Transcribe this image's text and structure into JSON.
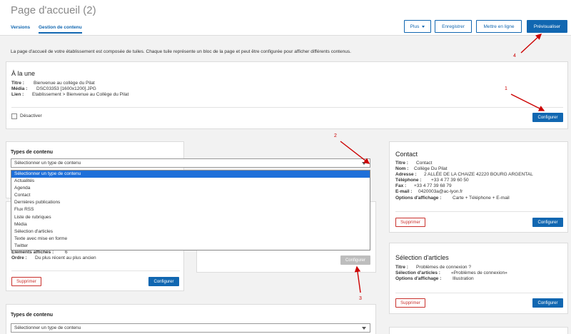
{
  "header": {
    "title": "Page d'accueil (2)",
    "tabs": [
      "Versions",
      "Gestion de contenu"
    ],
    "buttons": {
      "plus": "Plus",
      "enregistrer": "Enregistrer",
      "mettre_en_ligne": "Mettre en ligne",
      "previsualiser": "Prévisualiser"
    }
  },
  "intro": "La page d'accueil de votre établissement est composée de tuiles. Chaque tuile représente un bloc de la page et peut être configurée pour afficher différents contenus.",
  "a_la_une": {
    "title": "À la une",
    "rows": [
      {
        "k": "Titre :",
        "v": "Bienvenue au collège du Pilat"
      },
      {
        "k": "Média :",
        "v": "DSC03353 [1600x1200].JPG"
      },
      {
        "k": "Lien :",
        "v": "Etablissement > Bienvenue au Collège du Pilat"
      }
    ],
    "checkbox_label": "Désactiver",
    "configure": "Configurer"
  },
  "types_block_1": {
    "label": "Types de contenu",
    "select_value": "Sélectionner un type de contenu",
    "options": [
      "Sélectionner un type de contenu",
      "Actualités",
      "Agenda",
      "Contact",
      "Dernières publications",
      "Flux RSS",
      "Liste de rubriques",
      "Média",
      "Sélection d'articles",
      "Texte avec mise en forme",
      "Twitter"
    ]
  },
  "left_card_partial": {
    "rows": [
      {
        "k": "Eléments affichés :",
        "v": "6"
      },
      {
        "k": "Ordre :",
        "v": "Du plus récent au plus ancien"
      }
    ],
    "delete": "Supprimer",
    "configure": "Configurer"
  },
  "middle_card_partial": {
    "configure": "Configurer"
  },
  "contact_card": {
    "title": "Contact",
    "rows": [
      {
        "k": "Titre :",
        "v": "Contact"
      },
      {
        "k": "Nom :",
        "v": "Collège Du Pilat"
      },
      {
        "k": "Adresse :",
        "v": "2 ALLÉE DE LA CHAIZE 42220 BOURG ARGENTAL"
      },
      {
        "k": "Téléphone :",
        "v": "+33 4 77 39 60 50"
      },
      {
        "k": "Fax :",
        "v": "+33 4 77 39 68 79"
      },
      {
        "k": "E-mail :",
        "v": "0420003a@ac-lyon.fr"
      },
      {
        "k": "Options d'affichage :",
        "v": "Carte + Téléphone + E-mail"
      }
    ],
    "delete": "Supprimer",
    "configure": "Configurer"
  },
  "selection_card": {
    "title": "Sélection d'articles",
    "rows": [
      {
        "k": "Titre :",
        "v": "Problèmes de connexion ?"
      },
      {
        "k": "Sélection d'articles :",
        "v": "«Problèmes de connexion»"
      },
      {
        "k": "Options d'affichage :",
        "v": "Illustration"
      }
    ],
    "delete": "Supprimer",
    "configure": "Configurer"
  },
  "types_block_2": {
    "label": "Types de contenu",
    "select_value": "Sélectionner un type de contenu"
  },
  "annotations": [
    "1",
    "2",
    "3",
    "4"
  ],
  "colors": {
    "accent": "#1167b1",
    "danger": "#c9302c",
    "annotation": "#cc0000"
  }
}
